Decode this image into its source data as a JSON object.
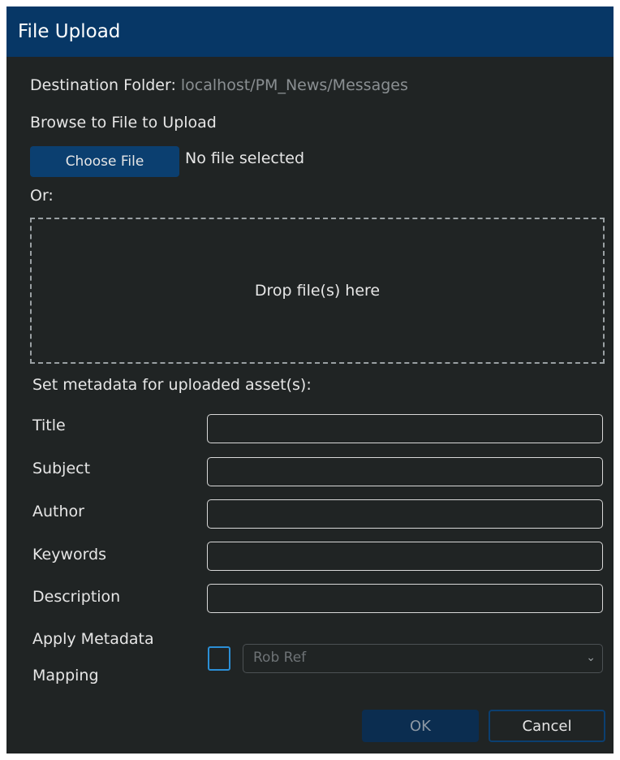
{
  "dialog": {
    "title": "File Upload"
  },
  "destination": {
    "label": "Destination Folder:",
    "path": "localhost/PM_News/Messages"
  },
  "browse": {
    "heading": "Browse to File to Upload",
    "choose_label": "Choose File",
    "status": "No file selected"
  },
  "or_label": "Or:",
  "dropzone": {
    "text": "Drop file(s) here"
  },
  "metadata": {
    "heading": "Set metadata for uploaded asset(s):",
    "fields": [
      {
        "label": "Title",
        "value": ""
      },
      {
        "label": "Subject",
        "value": ""
      },
      {
        "label": "Author",
        "value": ""
      },
      {
        "label": "Keywords",
        "value": ""
      },
      {
        "label": "Description",
        "value": ""
      }
    ],
    "mapping": {
      "label_line1": "Apply Metadata",
      "label_line2": "Mapping",
      "checked": false,
      "selected": "Rob Ref"
    }
  },
  "buttons": {
    "ok": "OK",
    "cancel": "Cancel"
  },
  "colors": {
    "titlebar": "#073766",
    "background": "#202424",
    "primary_button": "#0b3f70",
    "checkbox_border": "#2b8fd6"
  },
  "icons": {
    "select_chevron": "chevron-down-icon"
  }
}
